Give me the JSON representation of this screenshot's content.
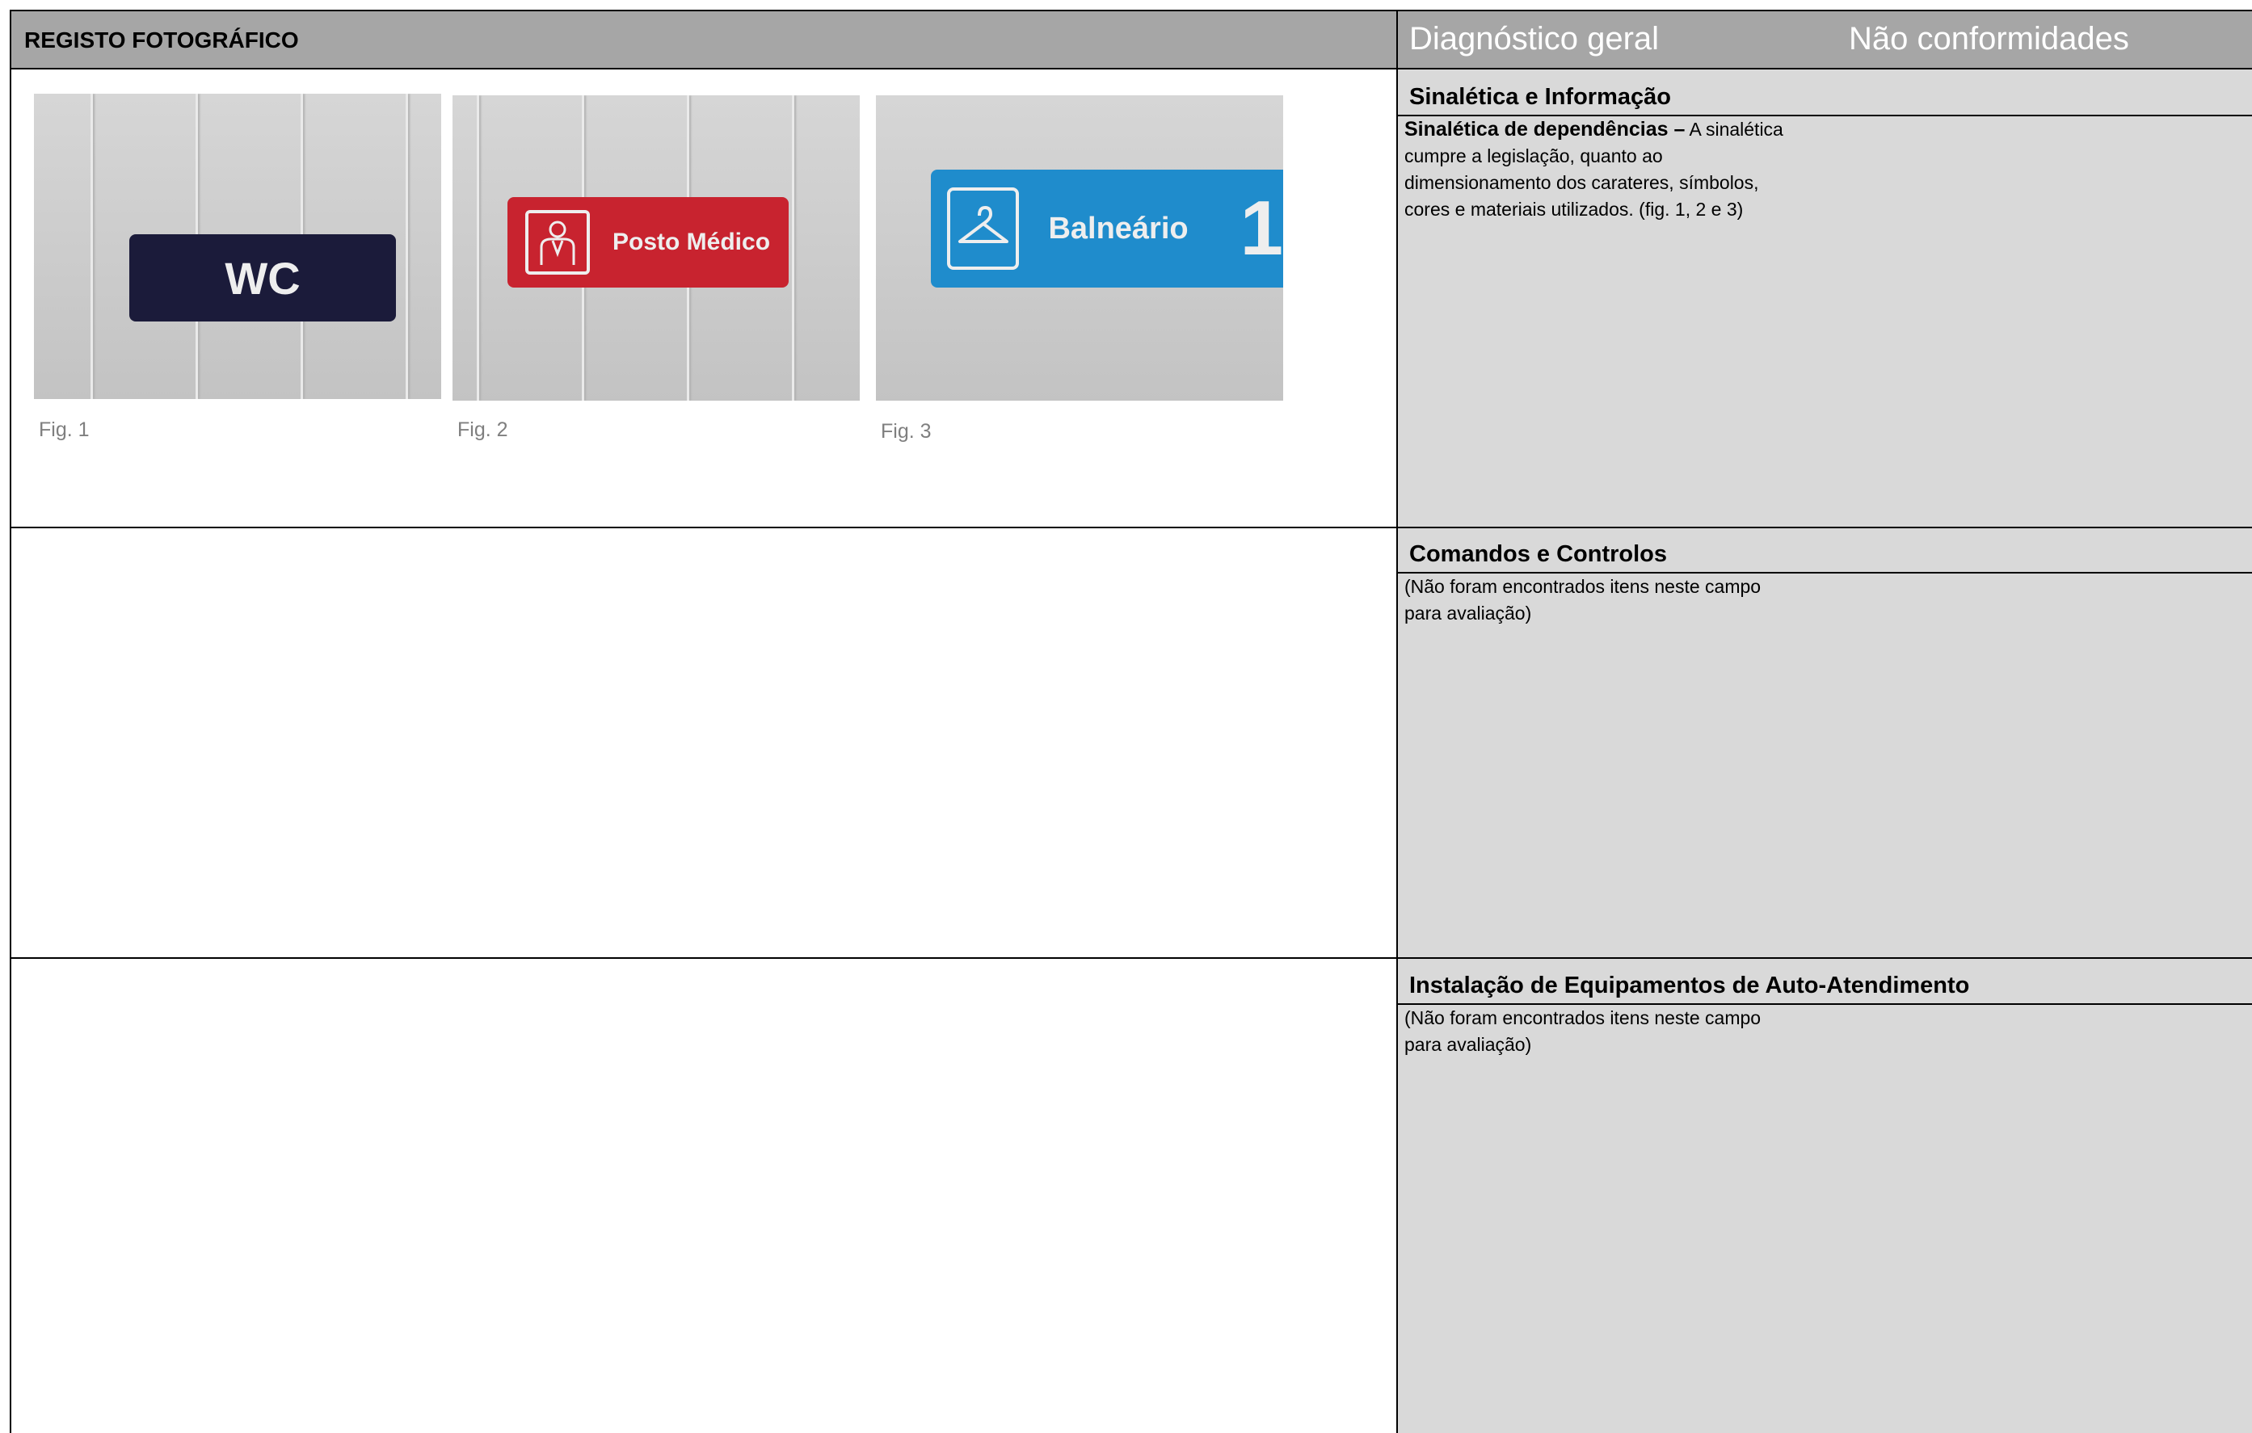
{
  "header": {
    "left_title": "REGISTO FOTOGRÁFICO",
    "right_title_1": "Diagnóstico geral",
    "right_title_2": "Não conformidades"
  },
  "photos": [
    {
      "sign_text": "WC",
      "caption": "Fig. 1",
      "sign_color": "#1b1b3a"
    },
    {
      "sign_text": "Posto Médico",
      "caption": "Fig. 2",
      "sign_color": "#c8232f"
    },
    {
      "sign_text": "Balneário",
      "sign_number": "1",
      "caption": "Fig. 3",
      "sign_color": "#1f8ccc"
    }
  ],
  "sections": [
    {
      "title": "Sinalética e Informação",
      "body_bold": "Sinalética de dependências –",
      "body_lines": [
        "A sinalética",
        "cumpre a legislação, quanto ao",
        "dimensionamento dos carateres, símbolos,",
        "cores e materiais utilizados. (fig. 1, 2 e 3)"
      ]
    },
    {
      "title": "Comandos e Controlos",
      "body_lines": [
        "(Não foram encontrados itens neste campo",
        "para avaliação)"
      ]
    },
    {
      "title": "Instalação de Equipamentos de Auto-Atendimento",
      "body_lines": [
        "(Não foram encontrados itens neste campo",
        "para avaliação)"
      ]
    }
  ],
  "colors": {
    "header_bg": "#a6a6a6",
    "panel_bg": "#d9d9d9",
    "caption_text": "#7f7f7f"
  }
}
